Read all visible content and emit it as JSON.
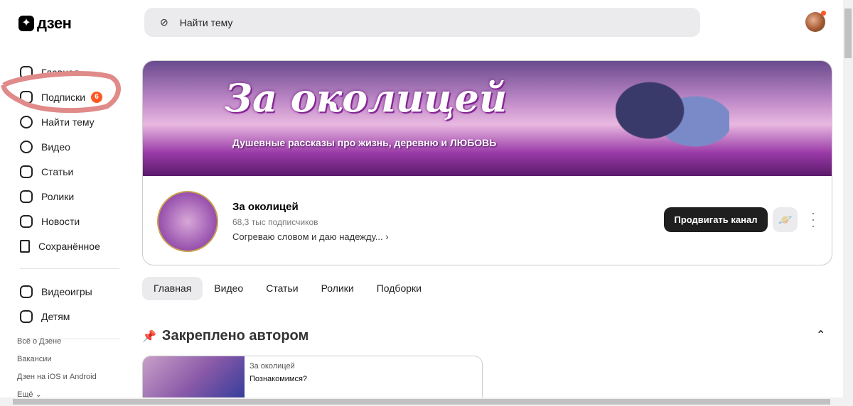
{
  "header": {
    "logo": "дзен",
    "search_placeholder": "Найти тему"
  },
  "sidebar": {
    "items": [
      {
        "label": "Главная",
        "icon": "home-icon"
      },
      {
        "label": "Подписки",
        "icon": "subscriptions-icon",
        "badge": "6"
      },
      {
        "label": "Найти тему",
        "icon": "compass-icon"
      },
      {
        "label": "Видео",
        "icon": "video-icon"
      },
      {
        "label": "Статьи",
        "icon": "articles-icon"
      },
      {
        "label": "Ролики",
        "icon": "shorts-icon"
      },
      {
        "label": "Новости",
        "icon": "news-icon"
      },
      {
        "label": "Сохранённое",
        "icon": "bookmark-icon"
      }
    ],
    "extra": [
      {
        "label": "Видеоигры",
        "icon": "gamepad-icon"
      },
      {
        "label": "Детям",
        "icon": "bear-icon"
      }
    ],
    "footer": [
      "Всё о Дзене",
      "Вакансии",
      "Дзен на iOS и Android",
      "Ещё"
    ]
  },
  "channel": {
    "banner_title": "За околицей",
    "banner_subtitle": "Душевные рассказы про жизнь, деревню и ЛЮБОВЬ",
    "avatar_text": "За околицей",
    "name": "За околицей",
    "subscribers": "68,3 тыс подписчиков",
    "description": "Согреваю словом и даю надежду...",
    "promote_label": "Продвигать канал"
  },
  "tabs": [
    "Главная",
    "Видео",
    "Статьи",
    "Ролики",
    "Подборки"
  ],
  "pinned": {
    "title": "Закреплено автором",
    "card": {
      "channel": "За околицей",
      "title": "Познакомимся?"
    }
  },
  "colors": {
    "badge": "#ff5722",
    "annotation": "#e08a8a"
  }
}
